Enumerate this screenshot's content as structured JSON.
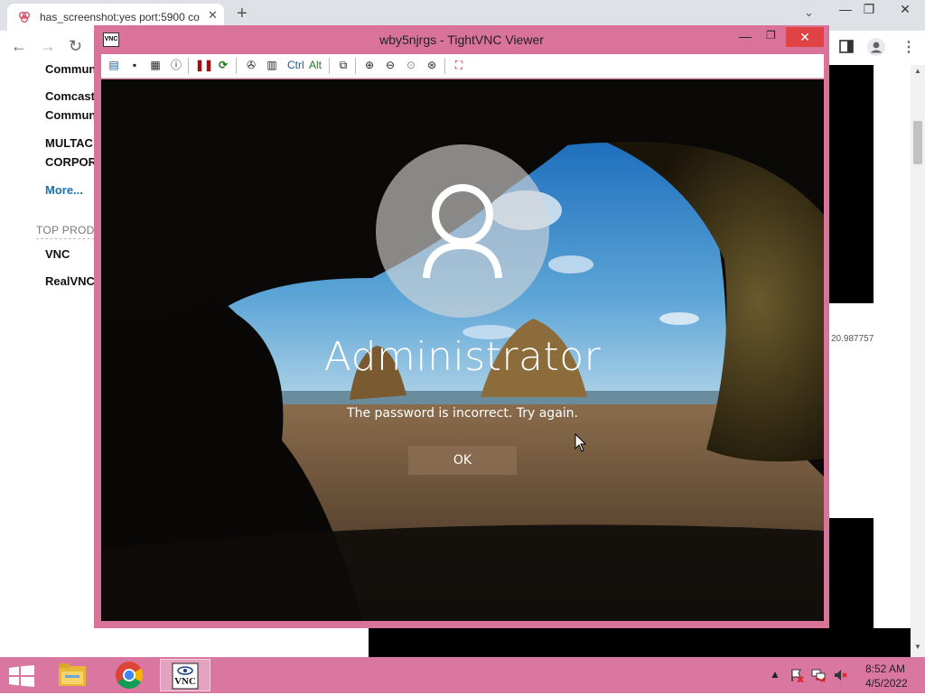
{
  "browser": {
    "tab_title": "has_screenshot:yes port:5900 co",
    "tab_close": "✕",
    "new_tab": "+",
    "tab_search": "⌄",
    "window_min": "—",
    "window_max": "❐",
    "window_close": "✕",
    "nav_back": "←",
    "nav_forward": "→",
    "nav_reload": "↻",
    "menu": "⋮"
  },
  "page": {
    "links": [
      "Commun",
      "Comcast",
      "Commun",
      "MULTAC",
      "CORPOR"
    ],
    "more_link": "More...",
    "top_products_heading": "TOP PRODU",
    "products": [
      "VNC",
      "RealVNC"
    ],
    "coordinate_text": "20.987757"
  },
  "vnc": {
    "window_title": "wby5njrgs - TightVNC Viewer",
    "app_icon_label": "VNC",
    "min": "—",
    "max": "❐",
    "close": "✕",
    "toolbar_ctrl": "Ctrl",
    "toolbar_alt": "Alt"
  },
  "lockscreen": {
    "account_name": "Administrator",
    "message": "The password is incorrect. Try again.",
    "ok_button": "OK"
  },
  "taskbar": {
    "time": "8:52 AM",
    "date": "4/5/2022",
    "tray_chevron": "▲",
    "accent_color": "#d977a1"
  }
}
